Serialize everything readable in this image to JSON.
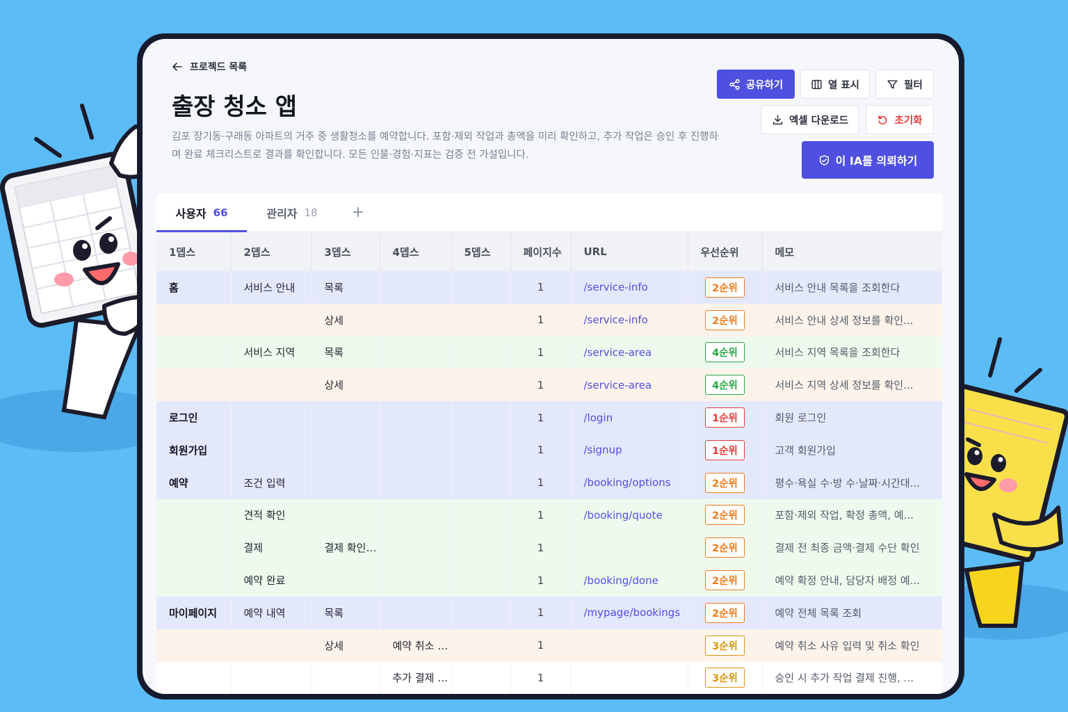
{
  "back_label": "프로젝드 목록",
  "title": "출장 청소 앱",
  "description": "김포 장기동·구래동 아파트의 거주 중 생활청소를 예약합니다. 포함·제외 작업과 총액을 미리 확인하고, 추가 작업은 승인 후 진행하며 완료 체크리스트로 결과를 확인합니다. 모든 인물·경험·지표는 검증 전 가설입니다.",
  "toolbar": {
    "share": "공유하기",
    "columns": "열 표시",
    "filter": "필터",
    "excel": "엑셀 다운로드",
    "reset": "초기화",
    "request": "이 IA를 의뢰하기"
  },
  "tabs": [
    {
      "label": "사용자",
      "count": "66"
    },
    {
      "label": "관리자",
      "count": "18"
    }
  ],
  "add_tab": "+",
  "columns": [
    "1뎁스",
    "2뎁스",
    "3뎁스",
    "4뎁스",
    "5뎁스",
    "페이지수",
    "URL",
    "우선순위",
    "메모"
  ],
  "rows": [
    {
      "d1": "홈",
      "d2": "서비스 안내",
      "d3": "목록",
      "d4": "",
      "d5": "",
      "pages": "1",
      "url": "/service-info",
      "priority": "2순위",
      "memo": "서비스 안내 목록을 조회한다"
    },
    {
      "d1": "",
      "d2": "",
      "d3": "상세",
      "d4": "",
      "d5": "",
      "pages": "1",
      "url": "/service-info",
      "priority": "2순위",
      "memo": "서비스 안내 상세 정보를 확인..."
    },
    {
      "d1": "",
      "d2": "서비스 지역",
      "d3": "목록",
      "d4": "",
      "d5": "",
      "pages": "1",
      "url": "/service-area",
      "priority": "4순위",
      "memo": "서비스 지역 목록을 조회한다"
    },
    {
      "d1": "",
      "d2": "",
      "d3": "상세",
      "d4": "",
      "d5": "",
      "pages": "1",
      "url": "/service-area",
      "priority": "4순위",
      "memo": "서비스 지역 상세 정보를 확인..."
    },
    {
      "d1": "로그인",
      "d2": "",
      "d3": "",
      "d4": "",
      "d5": "",
      "pages": "1",
      "url": "/login",
      "priority": "1순위",
      "memo": "회원 로그인"
    },
    {
      "d1": "회원가입",
      "d2": "",
      "d3": "",
      "d4": "",
      "d5": "",
      "pages": "1",
      "url": "/signup",
      "priority": "1순위",
      "memo": "고객 회원가입"
    },
    {
      "d1": "예약",
      "d2": "조건 입력",
      "d3": "",
      "d4": "",
      "d5": "",
      "pages": "1",
      "url": "/booking/options",
      "priority": "2순위",
      "memo": "평수·욕실 수·방 수·날짜·시간대..."
    },
    {
      "d1": "",
      "d2": "견적 확인",
      "d3": "",
      "d4": "",
      "d5": "",
      "pages": "1",
      "url": "/booking/quote",
      "priority": "2순위",
      "memo": "포함·제외 작업, 확정 총액, 예..."
    },
    {
      "d1": "",
      "d2": "결제",
      "d3": "결제 확인 모달",
      "d4": "",
      "d5": "",
      "pages": "1",
      "url": "",
      "priority": "2순위",
      "memo": "결제 전 최종 금액·결제 수단 확인"
    },
    {
      "d1": "",
      "d2": "예약 완료",
      "d3": "",
      "d4": "",
      "d5": "",
      "pages": "1",
      "url": "/booking/done",
      "priority": "2순위",
      "memo": "예약 확정 안내, 담당자 배정 예..."
    },
    {
      "d1": "마이페이지",
      "d2": "예약 내역",
      "d3": "목록",
      "d4": "",
      "d5": "",
      "pages": "1",
      "url": "/mypage/bookings",
      "priority": "2순위",
      "memo": "예약 전체 목록 조회"
    },
    {
      "d1": "",
      "d2": "",
      "d3": "상세",
      "d4": "예약 취소 모달",
      "d5": "",
      "pages": "1",
      "url": "",
      "priority": "3순위",
      "memo": "예약 취소 사유 입력 및 취소 확인"
    },
    {
      "d1": "",
      "d2": "",
      "d3": "",
      "d4": "추가 결제 모달",
      "d5": "",
      "pages": "1",
      "url": "",
      "priority": "3순위",
      "memo": "승인 시 추가 작업 결제 진행, ..."
    }
  ],
  "row_colors": [
    "blue",
    "orange",
    "green",
    "orange",
    "blue",
    "blue",
    "blue",
    "green",
    "green",
    "green",
    "blue",
    "orange",
    "white"
  ],
  "priority_colors": {
    "1순위": "#e23a3a",
    "2순위": "#f07a1a",
    "3순위": "#d9960c",
    "4순위": "#28a745"
  },
  "colors": {
    "background": "#5cbcf5",
    "accent": "#4f4fe0",
    "frame": "#161a2e"
  },
  "icons": [
    "arrow-left-icon",
    "share-icon",
    "columns-icon",
    "filter-icon",
    "download-icon",
    "reset-icon",
    "handshake-icon"
  ]
}
